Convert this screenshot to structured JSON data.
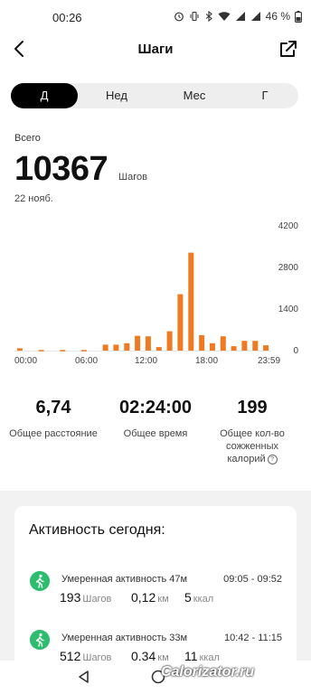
{
  "status": {
    "time": "00:26",
    "battery": "46 %"
  },
  "header": {
    "title": "Шаги",
    "back_icon": "chevron-left-icon",
    "share_icon": "share-icon"
  },
  "tabs": [
    {
      "label": "Д",
      "active": true
    },
    {
      "label": "Нед",
      "active": false
    },
    {
      "label": "Мес",
      "active": false
    },
    {
      "label": "Г",
      "active": false
    }
  ],
  "summary": {
    "total_label": "Всего",
    "steps": "10367",
    "unit": "Шагов",
    "date": "22 нояб."
  },
  "chart_data": {
    "type": "bar",
    "color": "#f07a22",
    "x_unit": "hour",
    "x": [
      0.5,
      2.5,
      4.5,
      6.5,
      8.5,
      9.5,
      10.5,
      11.5,
      12.5,
      13.5,
      14.5,
      15.5,
      16.5,
      17.5,
      18.5,
      19.5,
      20.5,
      21.5,
      22.5,
      23.5
    ],
    "values": [
      80,
      20,
      20,
      20,
      200,
      200,
      250,
      500,
      480,
      120,
      650,
      1900,
      3300,
      520,
      250,
      480,
      150,
      330,
      330,
      180
    ],
    "ylim": [
      0,
      4200
    ],
    "yticks": [
      "4200",
      "2800",
      "1400",
      "0"
    ],
    "xticks": [
      "00:00",
      "06:00",
      "12:00",
      "18:00",
      "23:59"
    ]
  },
  "stats": [
    {
      "value": "6,74",
      "label": "Общее расстояние"
    },
    {
      "value": "02:24:00",
      "label": "Общее время"
    },
    {
      "value": "199",
      "label": "Общее кол-во сожженных калорий"
    }
  ],
  "activity": {
    "title": "Активность сегодня:",
    "items": [
      {
        "name": "Умеренная активность 47м",
        "time": "09:05 - 09:52",
        "steps": "193",
        "steps_unit": "Шагов",
        "km": "0,12",
        "km_unit": "км",
        "kcal": "5",
        "kcal_unit": "ккал"
      },
      {
        "name": "Умеренная активность 33м",
        "time": "10:42 - 11:15",
        "steps": "512",
        "steps_unit": "Шагов",
        "km": "0,34",
        "km_unit": "км",
        "kcal": "11",
        "kcal_unit": "ккал"
      }
    ]
  },
  "watermark": "Calorizator.ru"
}
